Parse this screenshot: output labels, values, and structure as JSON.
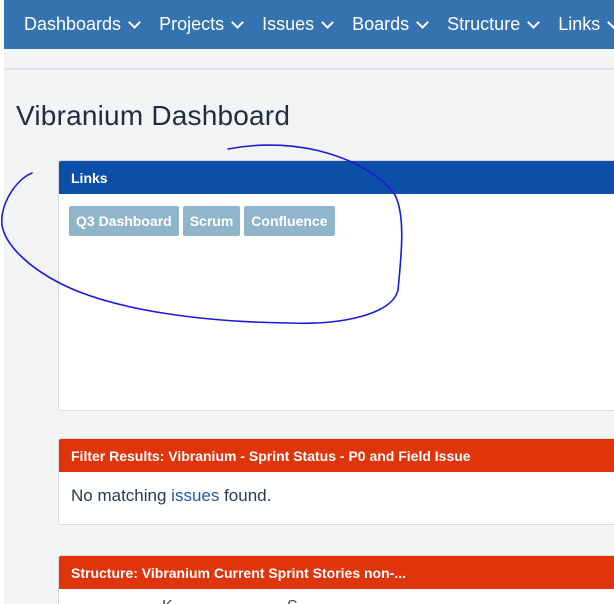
{
  "nav": {
    "items": [
      {
        "label": "Dashboards"
      },
      {
        "label": "Projects"
      },
      {
        "label": "Issues"
      },
      {
        "label": "Boards"
      },
      {
        "label": "Structure"
      },
      {
        "label": "Links"
      }
    ]
  },
  "page": {
    "title": "Vibranium Dashboard"
  },
  "links_gadget": {
    "title": "Links",
    "buttons": [
      {
        "label": "Q3 Dashboard"
      },
      {
        "label": "Scrum"
      },
      {
        "label": "Confluence"
      }
    ]
  },
  "filter_gadget": {
    "title": "Filter Results: Vibranium - Sprint Status - P0 and Field Issue",
    "message_prefix": "No matching ",
    "message_link": "issues",
    "message_suffix": " found."
  },
  "structure_gadget": {
    "title": "Structure: Vibranium Current Sprint Stories non-...",
    "fragment_1": "K",
    "fragment_2": "S"
  },
  "colors": {
    "nav_bg": "#3572b0",
    "links_header": "#0b4fa8",
    "red_header": "#e0340c",
    "link_button": "#8fb5cb",
    "annotation": "#1a1adc"
  }
}
